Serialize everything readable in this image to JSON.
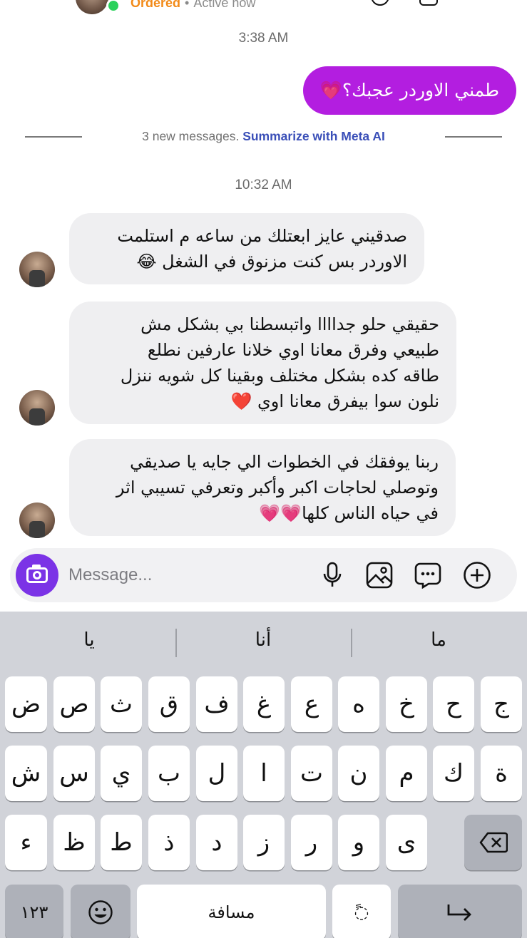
{
  "header": {
    "status_name": "Ordered",
    "separator": "•",
    "presence": "Active now"
  },
  "conversation": {
    "timestamp_1": "3:38 AM",
    "sent_message": "طمني الاوردر عجبك؟💗",
    "divider": {
      "text": "3 new messages.",
      "link": "Summarize with Meta AI"
    },
    "timestamp_2": "10:32 AM",
    "received": [
      {
        "lines": [
          "صدقيني عايز ابعتلك من ساعه م استلمت",
          "الاوردر بس كنت مزنوق في الشغل 😂"
        ]
      },
      {
        "lines": [
          "حقيقي حلو جداااا واتبسطنا بي بشكل مش",
          "طبيعي وفرق معانا اوي خلانا عارفين نطلع",
          "طاقه كده بشكل مختلف وبقينا كل شويه ننزل",
          "نلون سوا بيفرق معانا اوي ❤️"
        ]
      },
      {
        "lines": [
          "ربنا يوفقك في الخطوات الي جايه يا صديقي",
          "وتوصلي لحاجات اكبر وأكبر وتعرفي تسيبي اثر",
          "في حياه الناس كلها💗💗"
        ]
      }
    ]
  },
  "composer": {
    "placeholder": "Message...",
    "icons": [
      "camera-icon",
      "microphone-icon",
      "gallery-icon",
      "sticker-icon",
      "add-icon"
    ]
  },
  "keyboard": {
    "suggestions": [
      "يا",
      "أنا",
      "ما"
    ],
    "row1": [
      "ض",
      "ص",
      "ث",
      "ق",
      "ف",
      "غ",
      "ع",
      "ه",
      "خ",
      "ح",
      "ج"
    ],
    "row2": [
      "ش",
      "س",
      "ي",
      "ب",
      "ل",
      "ا",
      "ت",
      "ن",
      "م",
      "ك",
      "ة"
    ],
    "row3": [
      "ء",
      "ظ",
      "ط",
      "ذ",
      "د",
      "ز",
      "ر",
      "و",
      "ى"
    ],
    "numbers_key": "١٢٣",
    "space_key": "مسافة",
    "diacritic_key": "◌ً"
  },
  "colors": {
    "sent_bubble": "#b31ee0",
    "received_bubble": "#efeff1",
    "meta_link": "#3a4fb8",
    "camera_button": "#7b33e6",
    "status_orange": "#f28a18",
    "online_green": "#2bd15b",
    "keyboard_bg": "#d1d3d9"
  }
}
